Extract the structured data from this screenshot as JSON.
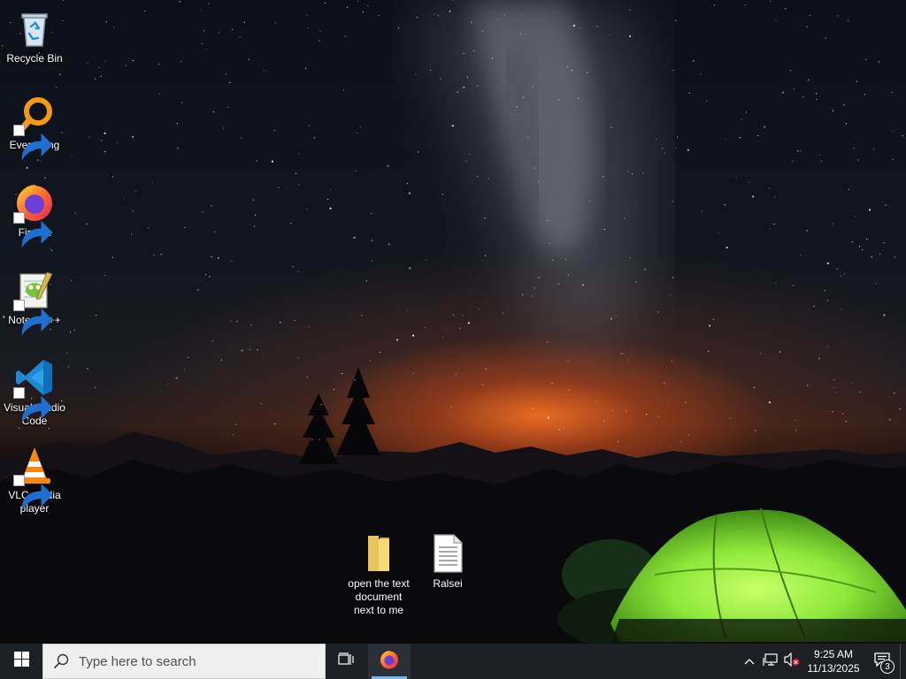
{
  "desktop": {
    "icons": [
      {
        "label": "Recycle Bin",
        "icon": "recycle-bin-icon"
      },
      {
        "label": "Everything",
        "icon": "everything-search-icon"
      },
      {
        "label": "Firefox",
        "icon": "firefox-icon"
      },
      {
        "label": "Notepad++",
        "icon": "notepad-plus-plus-icon"
      },
      {
        "label": "Visual Studio Code",
        "icon": "vscode-icon"
      },
      {
        "label": "VLC media player",
        "icon": "vlc-icon"
      },
      {
        "label": "open the text document next to me",
        "icon": "folder-icon"
      },
      {
        "label": "Ralsei",
        "icon": "text-document-icon"
      }
    ]
  },
  "taskbar": {
    "search_placeholder": "Type here to search",
    "pinned": [
      {
        "label": "Firefox",
        "icon": "firefox-icon",
        "active": true
      }
    ],
    "tray": {
      "time": "9:25 AM",
      "date": "11/13/2025",
      "notification_count": "3",
      "volume_muted": true
    }
  },
  "colors": {
    "taskbar": "#1c1f24",
    "accent": "#76b9ed",
    "tent": "#8ee83a"
  }
}
